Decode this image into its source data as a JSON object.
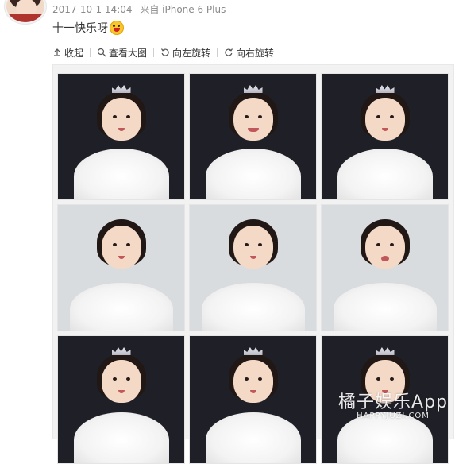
{
  "post": {
    "time": "2017-10-1 14:04",
    "source": "来自 iPhone 6 Plus",
    "text": "十一快乐呀"
  },
  "toolbar": {
    "collapse_label": "收起",
    "view_large_label": "查看大图",
    "rotate_left_label": "向左旋转",
    "rotate_right_label": "向右旋转"
  },
  "icons": {
    "collapse": "collapse-arrow-icon",
    "view_large": "magnifier-icon",
    "rotate_left": "rotate-left-icon",
    "rotate_right": "rotate-right-icon"
  },
  "photos": [
    {
      "bg": "dark",
      "crown": true,
      "mouth": "smile"
    },
    {
      "bg": "dark",
      "crown": true,
      "mouth": "grin"
    },
    {
      "bg": "dark",
      "crown": true,
      "mouth": "smile"
    },
    {
      "bg": "light",
      "crown": false,
      "mouth": "neutral"
    },
    {
      "bg": "light",
      "crown": false,
      "mouth": "neutral"
    },
    {
      "bg": "light",
      "crown": false,
      "mouth": "open"
    },
    {
      "bg": "dark",
      "crown": true,
      "mouth": "neutral"
    },
    {
      "bg": "dark",
      "crown": true,
      "mouth": "neutral"
    },
    {
      "bg": "dark",
      "crown": true,
      "mouth": "neutral"
    }
  ],
  "watermark": {
    "cn": "橘子娱乐App",
    "en": "HAPPYJUZI.COM"
  },
  "colors": {
    "dark_bg": "#1f1f27",
    "light_bg": "#d9dcdf",
    "meta_text": "#8a8a8a"
  }
}
